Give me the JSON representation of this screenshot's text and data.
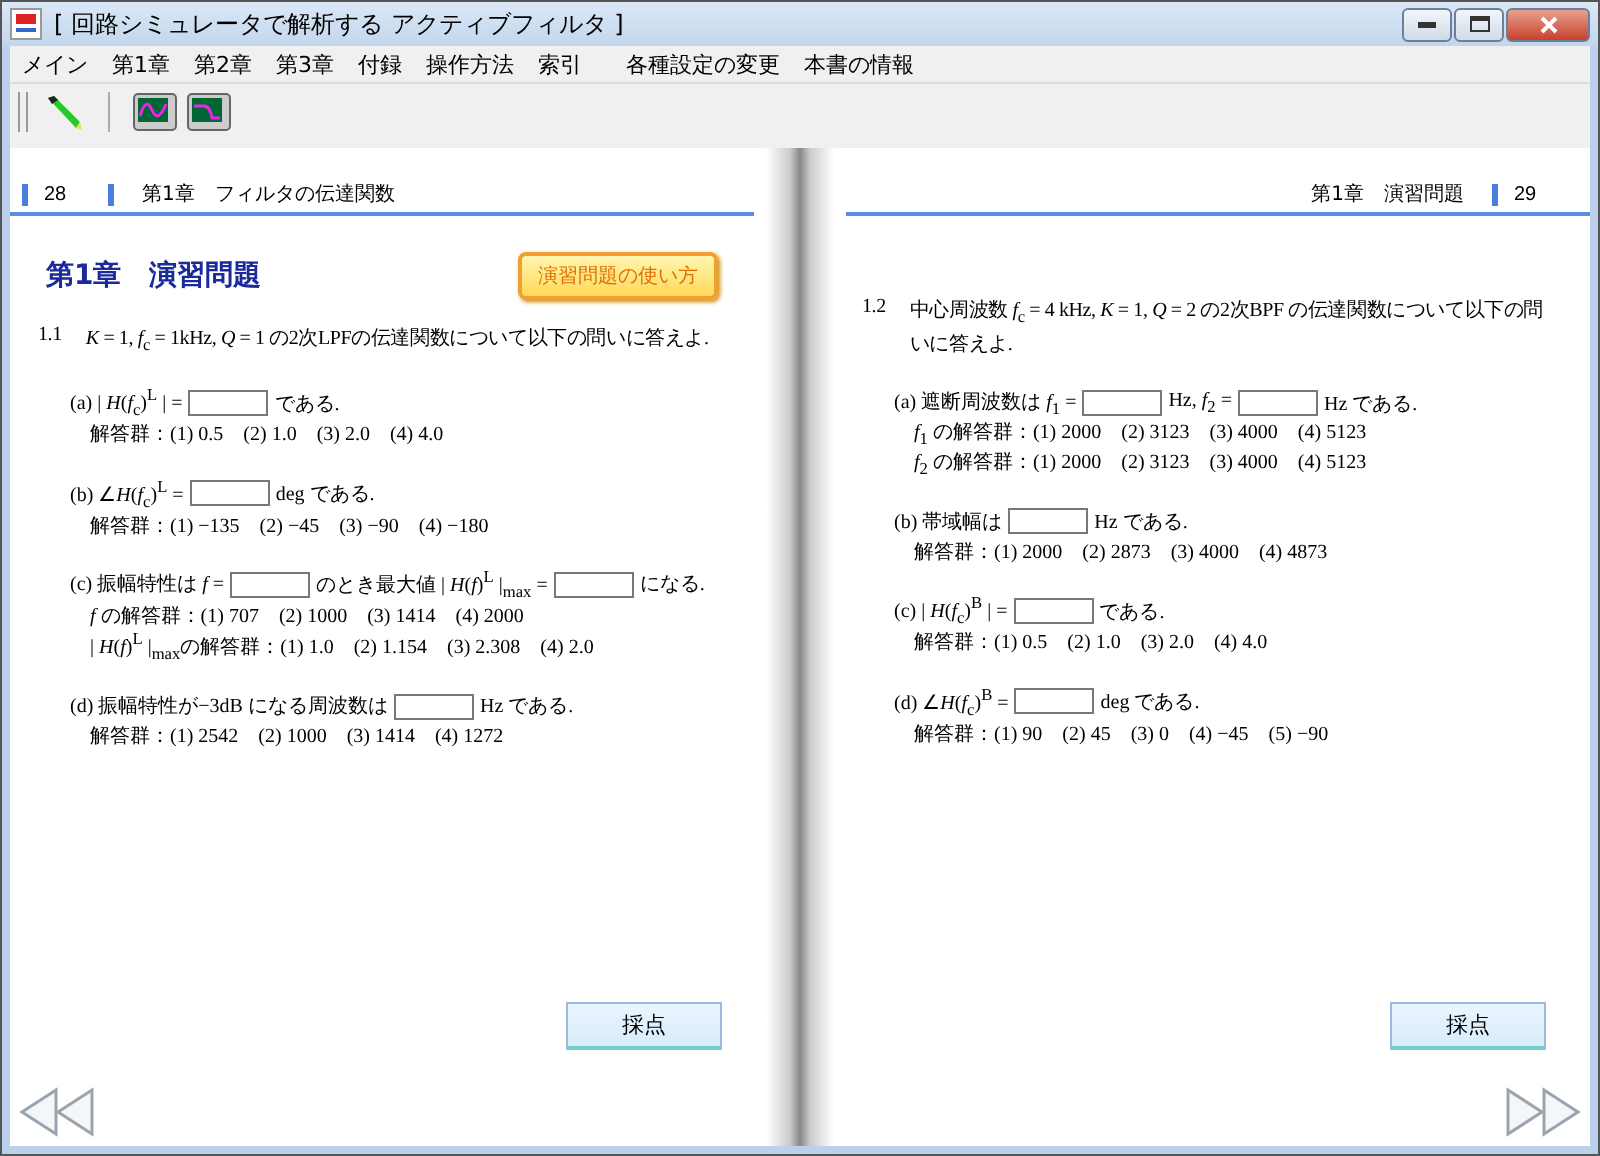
{
  "window": {
    "title": "[ 回路シミュレータで解析する アクティブフィルタ ]"
  },
  "menu": [
    "メイン",
    "第1章",
    "第2章",
    "第3章",
    "付録",
    "操作方法",
    "索引",
    "各種設定の変更",
    "本書の情報"
  ],
  "pages": [
    {
      "kind": "left",
      "page_number": "28",
      "header": "第1章　フィルタの伝達関数",
      "title": "第1章　演習問題",
      "help_button": "演習問題の使い方",
      "question_number": "1.1",
      "question": "*K* = 1, *f*$_{c}$ = 1kHz, *Q* = 1 の2次LPFの伝達関数について以下の問いに答えよ.",
      "items": [
        [
          [
            {
              "kind": "text",
              "text": "(a) | *H*(*f*$_{c}$)$^{L}$ | ="
            },
            {
              "kind": "box"
            },
            {
              "kind": "text",
              "text": "である."
            }
          ],
          [
            {
              "kind": "text",
              "text": "解答群：(1) 0.5　(2) 1.0　(3) 2.0　(4) 4.0"
            }
          ]
        ],
        [
          [
            {
              "kind": "text",
              "text": "(b) ∠*H*(*f*$_{c}$)$^{L}$ ="
            },
            {
              "kind": "box"
            },
            {
              "kind": "text",
              "text": "deg である."
            }
          ],
          [
            {
              "kind": "text",
              "text": "解答群：(1) −135　(2) −45　(3) −90　(4) −180"
            }
          ]
        ],
        [
          [
            {
              "kind": "text",
              "text": "(c) 振幅特性は *f* ="
            },
            {
              "kind": "box"
            },
            {
              "kind": "text",
              "text": "のとき最大値 | *H*(*f*)$^{L}$ |$_{max}$ ="
            },
            {
              "kind": "box"
            },
            {
              "kind": "text",
              "text": "になる."
            }
          ],
          [
            {
              "kind": "text",
              "text": "*f* の解答群：(1) 707　(2) 1000　(3) 1414　(4) 2000"
            }
          ],
          [
            {
              "kind": "text",
              "text": "| *H*(*f*)$^{L}$ |$_{max}$の解答群：(1) 1.0　(2) 1.154　(3) 2.308　(4) 2.0"
            }
          ]
        ],
        [
          [
            {
              "kind": "text",
              "text": "(d) 振幅特性が−3dB になる周波数は"
            },
            {
              "kind": "box"
            },
            {
              "kind": "text",
              "text": "Hz である."
            }
          ],
          [
            {
              "kind": "text",
              "text": "解答群：(1) 2542　(2) 1000　(3) 1414　(4) 1272"
            }
          ]
        ]
      ],
      "score_button": "採点"
    },
    {
      "kind": "right",
      "page_number": "29",
      "header": "第1章　演習問題",
      "question_number": "1.2",
      "question": "中心周波数 *f*$_{c}$ = 4 kHz, *K* = 1, *Q* = 2 の2次BPF の伝達関数について以下の問いに答えよ.",
      "items": [
        [
          [
            {
              "kind": "text",
              "text": "(a) 遮断周波数は *f*$_{1}$ ="
            },
            {
              "kind": "box"
            },
            {
              "kind": "text",
              "text": "Hz, *f*$_{2}$ ="
            },
            {
              "kind": "box"
            },
            {
              "kind": "text",
              "text": "Hz である."
            }
          ],
          [
            {
              "kind": "text",
              "text": "*f*$_{1}$ の解答群：(1) 2000　(2) 3123　(3) 4000　(4) 5123"
            }
          ],
          [
            {
              "kind": "text",
              "text": "*f*$_{2}$ の解答群：(1) 2000　(2) 3123　(3) 4000　(4) 5123"
            }
          ]
        ],
        [
          [
            {
              "kind": "text",
              "text": "(b) 帯域幅は"
            },
            {
              "kind": "box"
            },
            {
              "kind": "text",
              "text": "Hz である."
            }
          ],
          [
            {
              "kind": "text",
              "text": "解答群：(1) 2000　(2) 2873　(3) 4000　(4) 4873"
            }
          ]
        ],
        [
          [
            {
              "kind": "text",
              "text": "(c) | *H*(*f*$_{c}$)$^{B}$ | ="
            },
            {
              "kind": "box"
            },
            {
              "kind": "text",
              "text": "である."
            }
          ],
          [
            {
              "kind": "text",
              "text": "解答群：(1) 0.5　(2) 1.0　(3) 2.0　(4) 4.0"
            }
          ]
        ],
        [
          [
            {
              "kind": "text",
              "text": "(d) ∠*H*(*f*$_{c}$)$^{B}$ ="
            },
            {
              "kind": "box"
            },
            {
              "kind": "text",
              "text": "deg である."
            }
          ],
          [
            {
              "kind": "text",
              "text": "解答群：(1) 90　(2) 45　(3) 0　(4) −45　(5) −90"
            }
          ]
        ]
      ],
      "score_button": "採点"
    }
  ]
}
